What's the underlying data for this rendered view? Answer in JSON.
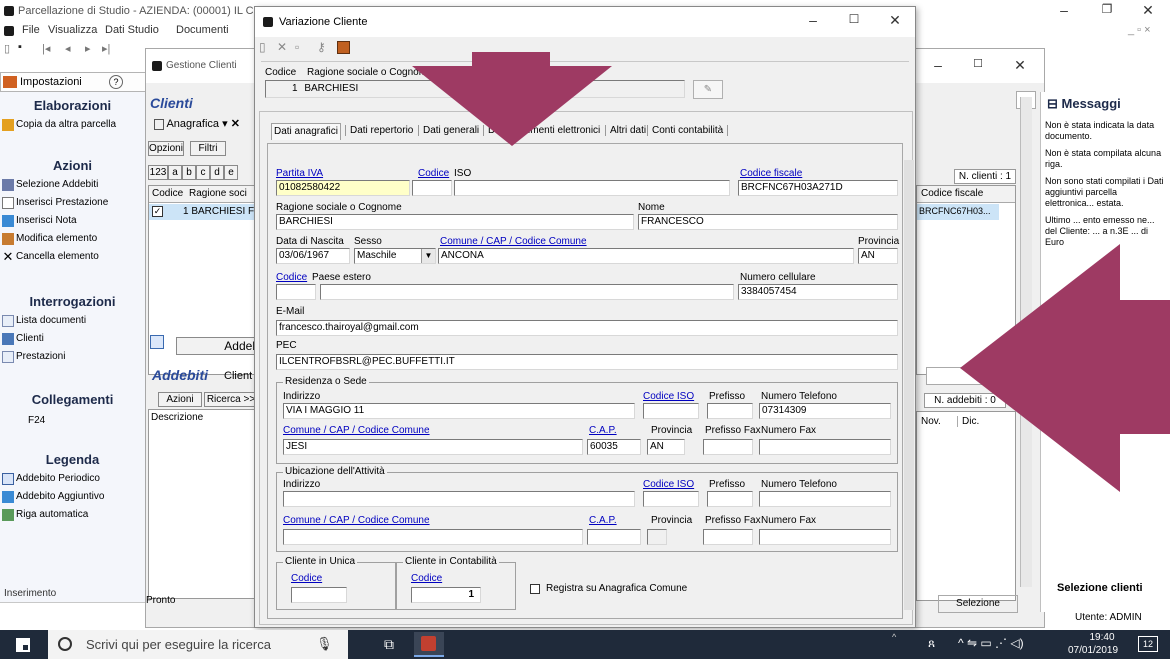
{
  "main_window": {
    "title": "Parcellazione di Studio - AZIENDA: (00001) IL C",
    "menu": [
      "File",
      "Visualizza",
      "Dati Studio",
      "Documenti"
    ],
    "tab_impostazioni": "Impostazioni"
  },
  "sidebar": {
    "elaborazioni": {
      "title": "Elaborazioni",
      "items": [
        "Copia da altra parcella"
      ]
    },
    "azioni": {
      "title": "Azioni",
      "items": [
        "Selezione Addebiti",
        "Inserisci Prestazione",
        "Inserisci Nota",
        "Modifica elemento",
        "Cancella elemento"
      ]
    },
    "interrogazioni": {
      "title": "Interrogazioni",
      "items": [
        "Lista documenti",
        "Clienti",
        "Prestazioni"
      ]
    },
    "collegamenti": {
      "title": "Collegamenti",
      "items": [
        "F24"
      ]
    },
    "legenda": {
      "title": "Legenda",
      "items": [
        "Addebito Periodico",
        "Addebito Aggiuntivo",
        "Riga automatica"
      ]
    },
    "status": "Inserimento"
  },
  "gestione": {
    "title": "Gestione Clienti",
    "heading": "Clienti",
    "anagrafica": "Anagrafica",
    "opzioni": "Opzioni",
    "filtri": "Filtri",
    "alpha": [
      "123",
      "a",
      "b",
      "c",
      "d",
      "e"
    ],
    "col_codice": "Codice",
    "col_ragione": "Ragione soci",
    "row_text": "1 BARCHIESI F",
    "n_clienti": "N. clienti : 1",
    "col_cf": "Codice fiscale",
    "row_cf": "BRCFNC67H03...",
    "addeb_btn": "Addeb",
    "addebiti_heading": "Addebiti",
    "addebiti_cliente": "Client",
    "azioni_btn": "Azioni",
    "ricerca_btn": "Ricerca >>",
    "descrizione": "Descrizione",
    "n_addebiti": "N. addebiti : 0",
    "col_nov": "Nov.",
    "col_dic": "Dic.",
    "pronto": "Pronto",
    "selezione": "Selezione",
    "utente": "Utente: ADMIN"
  },
  "messaggi": {
    "title": "Messaggi",
    "items": [
      "Non è stata indicata la data documento.",
      "Non è stata compilata alcuna riga.",
      "Non sono stati compilati i Dati aggiuntivi parcella elettronica... estata.",
      "Ultimo ... ento emesso ne... del Cliente: ... a n.3E ... di Euro"
    ],
    "footer": "Selezione clienti"
  },
  "dialog": {
    "title": "Variazione Cliente",
    "codice_label": "Codice",
    "ragione_label": "Ragione sociale o Cognome",
    "codice_value": "1",
    "ragione_value": "BARCHIESI",
    "tabs": [
      "Dati anagrafici",
      "Dati repertorio",
      "Dati generali",
      "Dati documenti elettronici",
      "Altri dati",
      "Conti contabilità"
    ],
    "partita_iva_label": "Partita IVA",
    "partita_iva": "01082580422",
    "codice_link": "Codice",
    "iso_label": "ISO",
    "codice_fiscale_label": "Codice fiscale",
    "codice_fiscale": "BRCFNC67H03A271D",
    "ragione_sociale_label": "Ragione sociale o Cognome",
    "ragione_sociale": "BARCHIESI",
    "nome_label": "Nome",
    "nome": "FRANCESCO",
    "data_nascita_label": "Data di Nascita",
    "data_nascita": "03/06/1967",
    "sesso_label": "Sesso",
    "sesso": "Maschile",
    "comune_label": "Comune / CAP / Codice Comune",
    "comune": "ANCONA",
    "provincia_label": "Provincia",
    "provincia": "AN",
    "codice2_label": "Codice",
    "paese_estero_label": "Paese estero",
    "cellulare_label": "Numero cellulare",
    "cellulare": "3384057454",
    "email_label": "E-Mail",
    "email": "francesco.thairoyal@gmail.com",
    "pec_label": "PEC",
    "pec": "ILCENTROFBSRL@PEC.BUFFETTI.IT",
    "residenza_title": "Residenza o Sede",
    "indirizzo_label": "Indirizzo",
    "indirizzo": "VIA I MAGGIO 11",
    "codice_iso_label": "Codice ISO",
    "prefisso_label": "Prefisso",
    "numero_tel_label": "Numero Telefono",
    "telefono": "07314309",
    "comune2_label": "Comune / CAP / Codice Comune",
    "cap_label": "C.A.P.",
    "provincia2_label": "Provincia",
    "prefisso_fax_label": "Prefisso Fax",
    "numero_fax_label": "Numero Fax",
    "comune_res": "JESI",
    "cap": "60035",
    "provincia_res": "AN",
    "ubicazione_title": "Ubicazione dell'Attività",
    "cliente_unica_title": "Cliente in Unica",
    "cliente_contab_title": "Cliente in Contabilità",
    "contab_codice": "1",
    "registra_label": "Registra su Anagrafica Comune"
  },
  "taskbar": {
    "search_placeholder": "Scrivi qui per eseguire la ricerca",
    "time": "19:40",
    "date": "07/01/2019",
    "notif": "12"
  },
  "colors": {
    "arrow": "#9e3a63",
    "sidebar_bg": "#f4f6fb",
    "taskbar": "#1f2a3a",
    "highlight_field": "#ffffc8"
  }
}
